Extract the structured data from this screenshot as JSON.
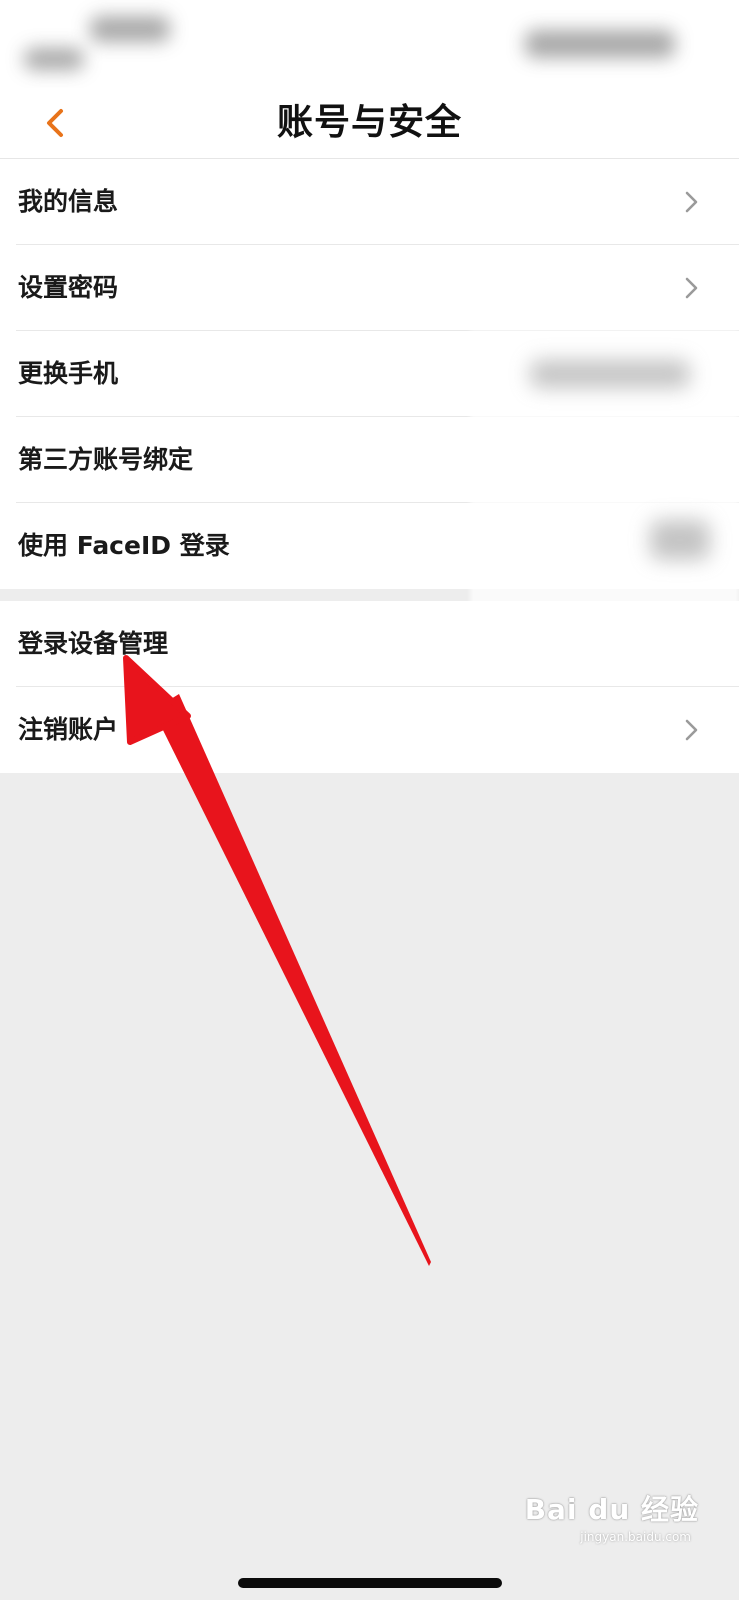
{
  "nav": {
    "title": "账号与安全",
    "back_icon": "chevron-left-icon",
    "accent_color": "#e8731a"
  },
  "menu": {
    "group1": [
      {
        "label": "我的信息"
      },
      {
        "label": "设置密码"
      },
      {
        "label": "更换手机"
      },
      {
        "label": "第三方账号绑定"
      },
      {
        "label": "使用 FaceID 登录"
      }
    ],
    "group2": [
      {
        "label": "登录设备管理"
      },
      {
        "label": "注销账户"
      }
    ]
  },
  "annotation": {
    "arrow_color": "#e8141c"
  },
  "watermark": {
    "text": "Bai du 经验",
    "sub": "jingyan.baidu.com"
  }
}
